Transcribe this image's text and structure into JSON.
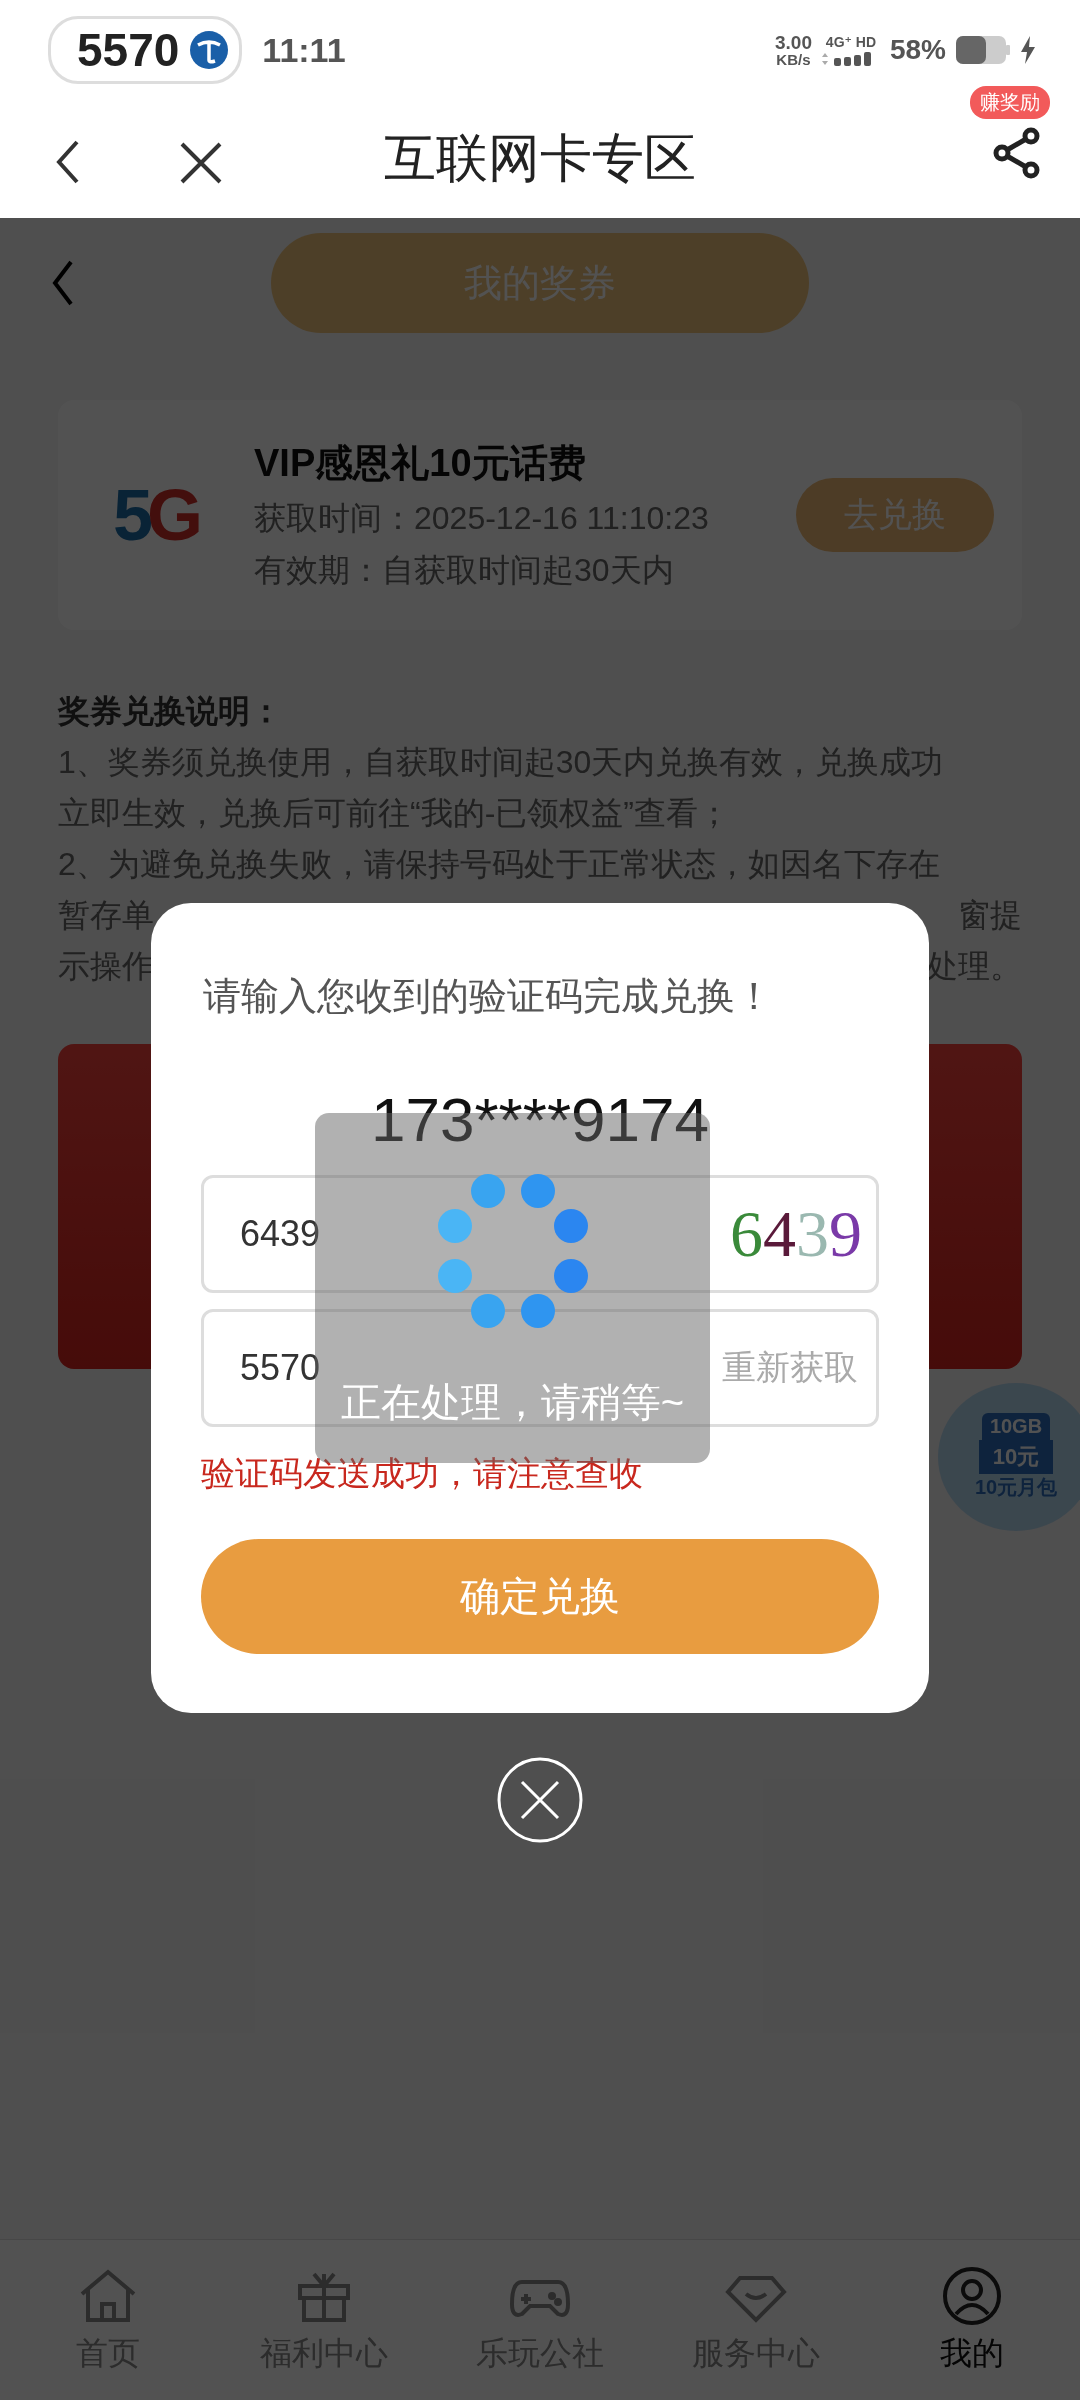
{
  "status_bar": {
    "carrier_number": "5570",
    "time": "11:11",
    "speed": "3.00",
    "speed_unit": "KB/s",
    "network": "4G⁺ HD",
    "battery": "58%"
  },
  "header": {
    "title": "互联网卡专区",
    "reward_badge": "赚奖励"
  },
  "page": {
    "title_button": "我的奖券",
    "voucher": {
      "logo": "5G",
      "title": "VIP感恩礼10元话费",
      "obtained": "获取时间：2025-12-16 11:10:23",
      "validity": "有效期：自获取时间起30天内",
      "action": "去兑换"
    },
    "notes_title": "奖券兑换说明：",
    "notes_lines": [
      {
        "left": "1、奖券须兑换使用，自获取时间起30天内兑换有效，兑换成功"
      },
      {
        "left": "立即生效，兑换后可前往“我的-已领权益”查看；"
      },
      {
        "left": "2、为避免兑换失败，请保持号码处于正常状态，如因名下存在"
      },
      {
        "left": "暂存单",
        "right": "窗提"
      },
      {
        "left": "示操作",
        "right": "处理。"
      }
    ],
    "floating_ad": [
      "10GB",
      "10元",
      "10元月包"
    ]
  },
  "dialog": {
    "prompt": "请输入您收到的验证码完成兑换！",
    "phone": "173****9174",
    "fields": [
      {
        "kind": "captcha",
        "value": "6439",
        "captcha": "6439"
      },
      {
        "kind": "sms",
        "value": "5570",
        "action": "重新获取"
      }
    ],
    "message": "验证码发送成功，请注意查收",
    "confirm": "确定兑换"
  },
  "toast": {
    "text": "正在处理，请稍等~"
  },
  "bottom_nav": [
    {
      "label": "首页",
      "selected": false
    },
    {
      "label": "福利中心",
      "selected": false
    },
    {
      "label": "乐玩公社",
      "selected": false
    },
    {
      "label": "服务中心",
      "selected": false
    },
    {
      "label": "我的",
      "selected": true
    }
  ]
}
